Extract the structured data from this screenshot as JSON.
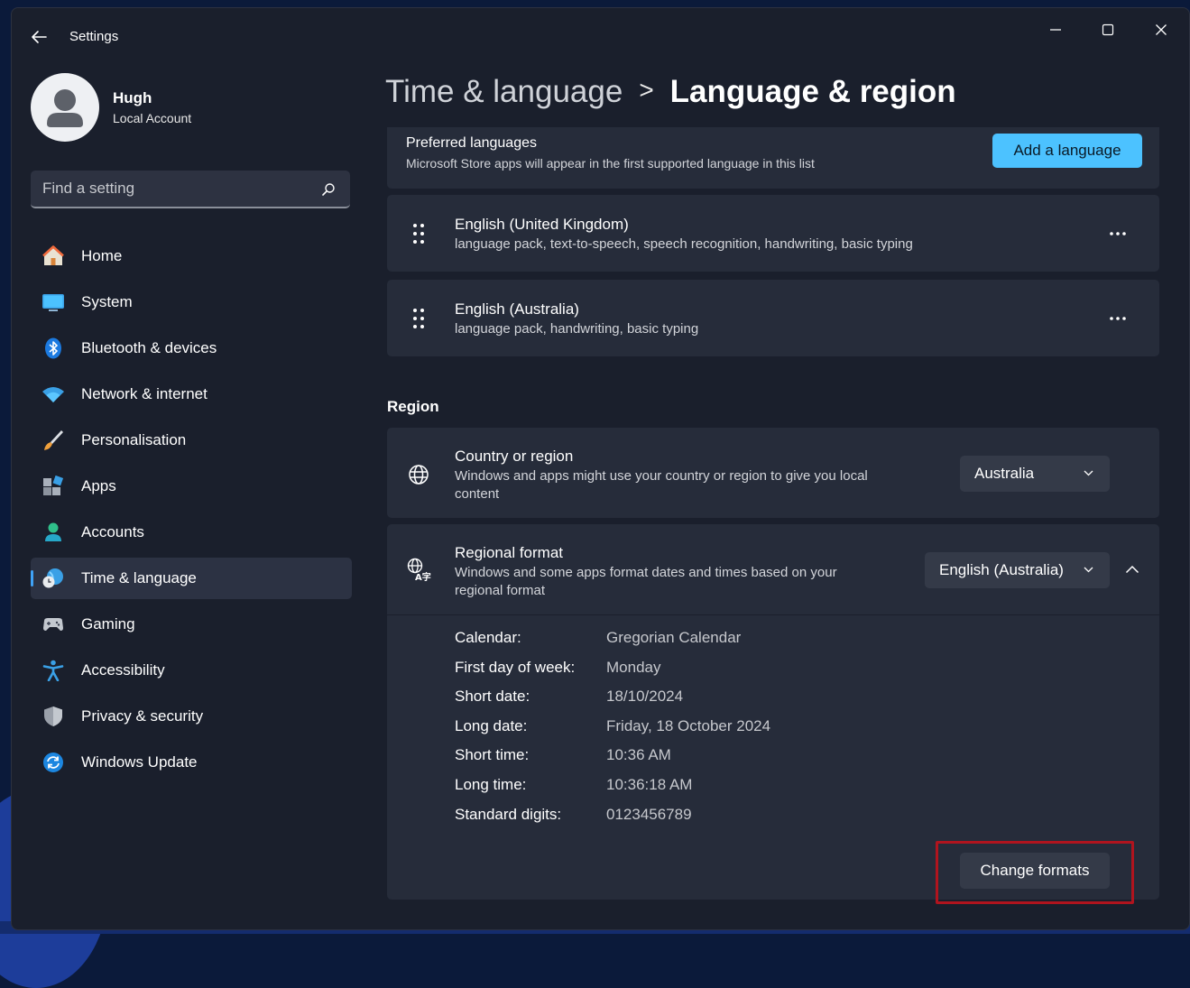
{
  "window": {
    "title": "Settings",
    "controls": {
      "minimize_icon": "minimize-icon",
      "maximize_icon": "maximize-icon",
      "close_icon": "close-icon"
    }
  },
  "user": {
    "name": "Hugh",
    "account_type": "Local Account"
  },
  "search": {
    "placeholder": "Find a setting",
    "icon": "search-icon"
  },
  "sidebar": {
    "items": [
      {
        "label": "Home",
        "icon": "home-icon"
      },
      {
        "label": "System",
        "icon": "system-icon"
      },
      {
        "label": "Bluetooth & devices",
        "icon": "bluetooth-icon"
      },
      {
        "label": "Network & internet",
        "icon": "wifi-icon"
      },
      {
        "label": "Personalisation",
        "icon": "brush-icon"
      },
      {
        "label": "Apps",
        "icon": "apps-icon"
      },
      {
        "label": "Accounts",
        "icon": "accounts-icon"
      },
      {
        "label": "Time & language",
        "icon": "time-language-icon",
        "active": true
      },
      {
        "label": "Gaming",
        "icon": "gaming-icon"
      },
      {
        "label": "Accessibility",
        "icon": "accessibility-icon"
      },
      {
        "label": "Privacy & security",
        "icon": "shield-icon"
      },
      {
        "label": "Windows Update",
        "icon": "windows-update-icon"
      }
    ]
  },
  "breadcrumb": {
    "parent": "Time & language",
    "separator": ">",
    "current": "Language & region"
  },
  "preferred": {
    "title": "Preferred languages",
    "subtitle": "Microsoft Store apps will appear in the first supported language in this list",
    "add_button": "Add a language"
  },
  "languages": [
    {
      "name": "English (United Kingdom)",
      "features": "language pack, text-to-speech, speech recognition, handwriting, basic typing"
    },
    {
      "name": "English (Australia)",
      "features": "language pack, handwriting, basic typing"
    }
  ],
  "region": {
    "heading": "Region",
    "country": {
      "title": "Country or region",
      "desc_line1": "Windows and apps might use your country or region to give you local",
      "desc_line2": "content",
      "value": "Australia"
    },
    "format": {
      "title": "Regional format",
      "desc_line1": "Windows and some apps format dates and times based on your",
      "desc_line2": "regional format",
      "value": "English (Australia)",
      "expanded": true
    },
    "details": [
      {
        "label": "Calendar:",
        "value": "Gregorian Calendar"
      },
      {
        "label": "First day of week:",
        "value": "Monday"
      },
      {
        "label": "Short date:",
        "value": "18/10/2024"
      },
      {
        "label": "Long date:",
        "value": "Friday, 18 October 2024"
      },
      {
        "label": "Short time:",
        "value": "10:36 AM"
      },
      {
        "label": "Long time:",
        "value": "10:36:18 AM"
      },
      {
        "label": "Standard digits:",
        "value": "0123456789"
      }
    ],
    "change_button": "Change formats"
  },
  "colors": {
    "accent": "#4cc2ff",
    "window_bg": "#1a1f2c",
    "card_bg": "#262c3a",
    "highlight": "#b0141e"
  }
}
